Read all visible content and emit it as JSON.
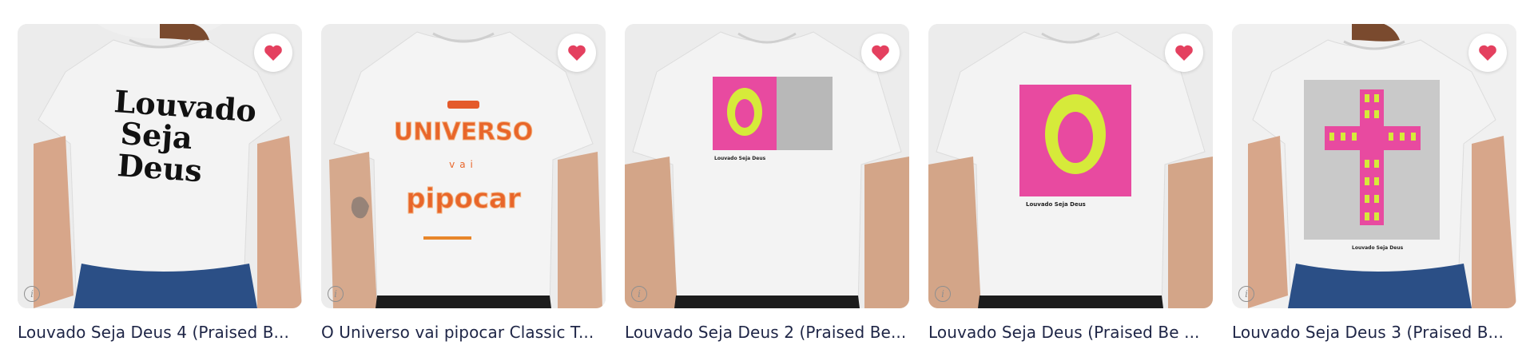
{
  "products": [
    {
      "title": "Louvado Seja Deus 4 (Praised B...",
      "print_lines": [
        "Louvado",
        "Seja",
        "Deus"
      ]
    },
    {
      "title": "O Universo vai pipocar Classic T...",
      "print_lines": [
        "UNIVERSO",
        "vai",
        "pipocar"
      ]
    },
    {
      "title": "Louvado Seja Deus 2 (Praised Be...",
      "print_lines": [
        "Louvado Seja Deus"
      ]
    },
    {
      "title": "Louvado Seja Deus (Praised Be ...",
      "print_lines": [
        "Louvado Seja Deus"
      ]
    },
    {
      "title": "Louvado Seja Deus 3 (Praised B...",
      "print_lines": [
        "Louvado Seja Deus"
      ]
    }
  ],
  "icons": {
    "favorite": "heart-icon",
    "info": "info-icon"
  },
  "colors": {
    "heart": "#e4405f",
    "title_text": "#1e2546",
    "pink": "#e84aa0",
    "yellow": "#d6ea3a",
    "orange": "#e8662a"
  }
}
